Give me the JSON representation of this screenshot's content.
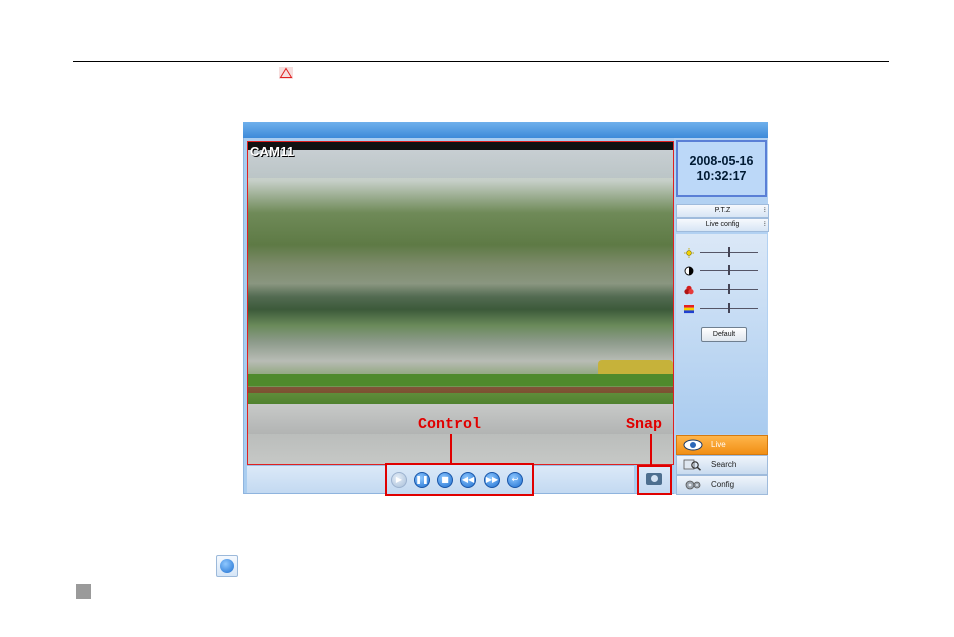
{
  "annotations": {
    "control_label": "Control",
    "snap_label": "Snap"
  },
  "video": {
    "camera_name": "CAM11"
  },
  "side_panel": {
    "date": "2008-05-16",
    "time": "10:32:17",
    "tabs": [
      "P.T.Z",
      "Live config"
    ],
    "tab_menu_glyph": "⁝",
    "default_button": "Default",
    "sliders": [
      {
        "icon": "brightness-icon",
        "level": 0.5
      },
      {
        "icon": "contrast-icon",
        "level": 0.5
      },
      {
        "icon": "saturation-icon",
        "level": 0.5
      },
      {
        "icon": "hue-icon",
        "level": 0.5
      }
    ],
    "nav": [
      "Live",
      "Search",
      "Config"
    ],
    "nav_active": "Live"
  },
  "controls": {
    "buttons": [
      "play",
      "pause",
      "stop",
      "rewind",
      "fast-forward",
      "exit"
    ],
    "glyphs": [
      "▶",
      "❚❚",
      "■",
      "◀◀",
      "▶▶",
      "↩"
    ]
  },
  "colors": {
    "annotation": "#e00000",
    "active_nav": "#f18f14",
    "clock_border": "#5a7fd6"
  }
}
